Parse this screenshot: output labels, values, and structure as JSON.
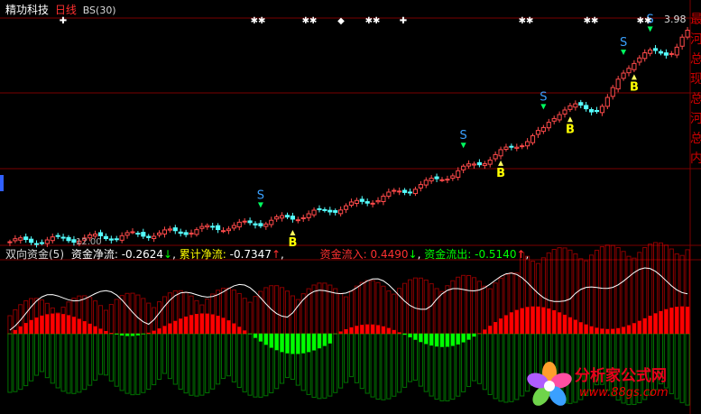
{
  "header": {
    "stock_name": "精功科技",
    "period": "日线",
    "indicator": "BS(30)"
  },
  "price_panel": {
    "top_price": "3.98",
    "signal_labels": {
      "sell": "S",
      "buy": "B"
    },
    "marker_rows": {
      "star": "✱✱",
      "diamond": "◆",
      "cross": "✚"
    },
    "right_edge_chars": [
      "最",
      "河",
      "总",
      "现",
      "总",
      "河",
      "总",
      "内"
    ],
    "left_label": "12.00"
  },
  "indicator_panel": {
    "name": "双向资金(5)",
    "net_label": "资金净流:",
    "net_value": "-0.2624",
    "net_arrow": "↓",
    "cum_label": "累计净流:",
    "cum_value": "-0.7347",
    "cum_arrow": "↑",
    "in_label": "资金流入:",
    "in_value": "0.4490",
    "in_arrow": "↓",
    "out_label": "资金流出:",
    "out_value": "-0.5140",
    "out_arrow": "↑"
  },
  "watermark": {
    "title": "分析家公式网",
    "url": "www.88gs.com"
  },
  "colors": {
    "up": "#ff4a4a",
    "down": "#55ffff",
    "grid": "#7a0000",
    "net_line": "#ffffff",
    "inflow": "#ff0000",
    "outflow": "#00ff00",
    "sell": "#3aa0ff",
    "buy": "#ffff00"
  },
  "chart_data": {
    "type": "candlestick",
    "count": 128,
    "last_close": 3.98,
    "signals_sell_index": [
      47,
      85,
      100,
      115,
      120
    ],
    "signals_buy_index": [
      53,
      92,
      105,
      117
    ],
    "net_flow_last": -0.2624,
    "cum_flow_last": -0.7347,
    "inflow_last": 0.449,
    "outflow_last": -0.514
  }
}
